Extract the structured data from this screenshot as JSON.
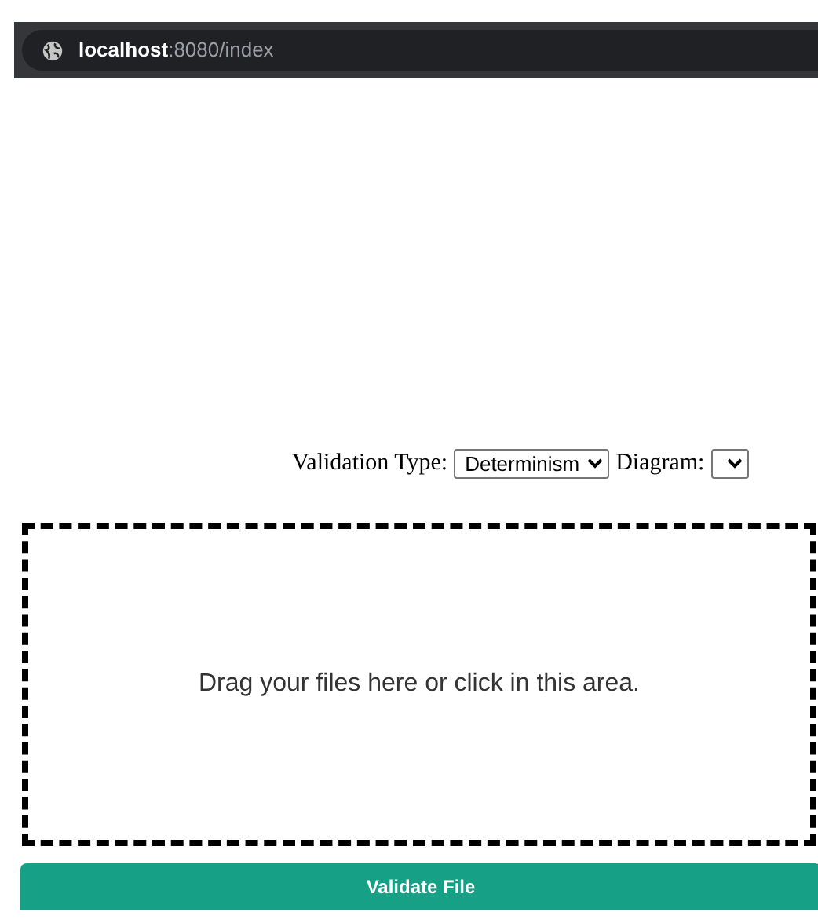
{
  "address_bar": {
    "host": "localhost",
    "path": ":8080/index"
  },
  "form": {
    "validation_type_label": "Validation Type:",
    "validation_type_value": "Determinism",
    "diagram_label": "Diagram:"
  },
  "drop_zone": {
    "text": "Drag your files here or click in this area."
  },
  "validate_button": {
    "label": "Validate File"
  }
}
